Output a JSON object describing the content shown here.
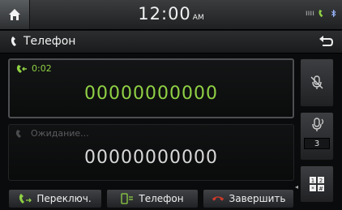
{
  "status_bar": {
    "time": "12:00",
    "ampm": "AM",
    "signal_text": "ıııı"
  },
  "title_bar": {
    "title": "Телефон"
  },
  "active_call": {
    "duration": "0:02",
    "number": "00000000000"
  },
  "waiting_call": {
    "status": "Ожидание...",
    "number": "00000000000"
  },
  "side_buttons": {
    "volume_count": "3"
  },
  "bottom_buttons": {
    "switch_label": "Переключ.",
    "phone_label": "Телефон",
    "end_label": "Завершить"
  },
  "colors": {
    "accent_green": "#8fd044",
    "end_red": "#d23a2a"
  }
}
